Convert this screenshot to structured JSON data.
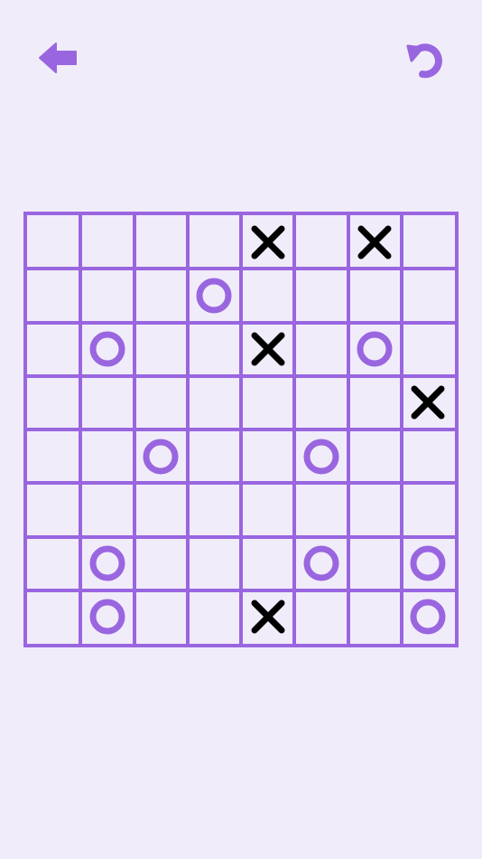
{
  "toolbar": {
    "back_icon": "arrow-left-icon",
    "undo_icon": "undo-icon"
  },
  "colors": {
    "background": "#f1ecfa",
    "accent": "#9966e0",
    "x_mark": "#000000",
    "o_mark": "#9966e0"
  },
  "board": {
    "rows": 8,
    "cols": 8,
    "cells": [
      [
        "",
        "",
        "",
        "",
        "X",
        "",
        "X",
        ""
      ],
      [
        "",
        "",
        "",
        "O",
        "",
        "",
        "",
        ""
      ],
      [
        "",
        "O",
        "",
        "",
        "X",
        "",
        "O",
        ""
      ],
      [
        "",
        "",
        "",
        "",
        "",
        "",
        "",
        "X"
      ],
      [
        "",
        "",
        "O",
        "",
        "",
        "O",
        "",
        ""
      ],
      [
        "",
        "",
        "",
        "",
        "",
        "",
        "",
        ""
      ],
      [
        "",
        "O",
        "",
        "",
        "",
        "O",
        "",
        "O"
      ],
      [
        "",
        "O",
        "",
        "",
        "X",
        "",
        "",
        "O"
      ]
    ]
  }
}
